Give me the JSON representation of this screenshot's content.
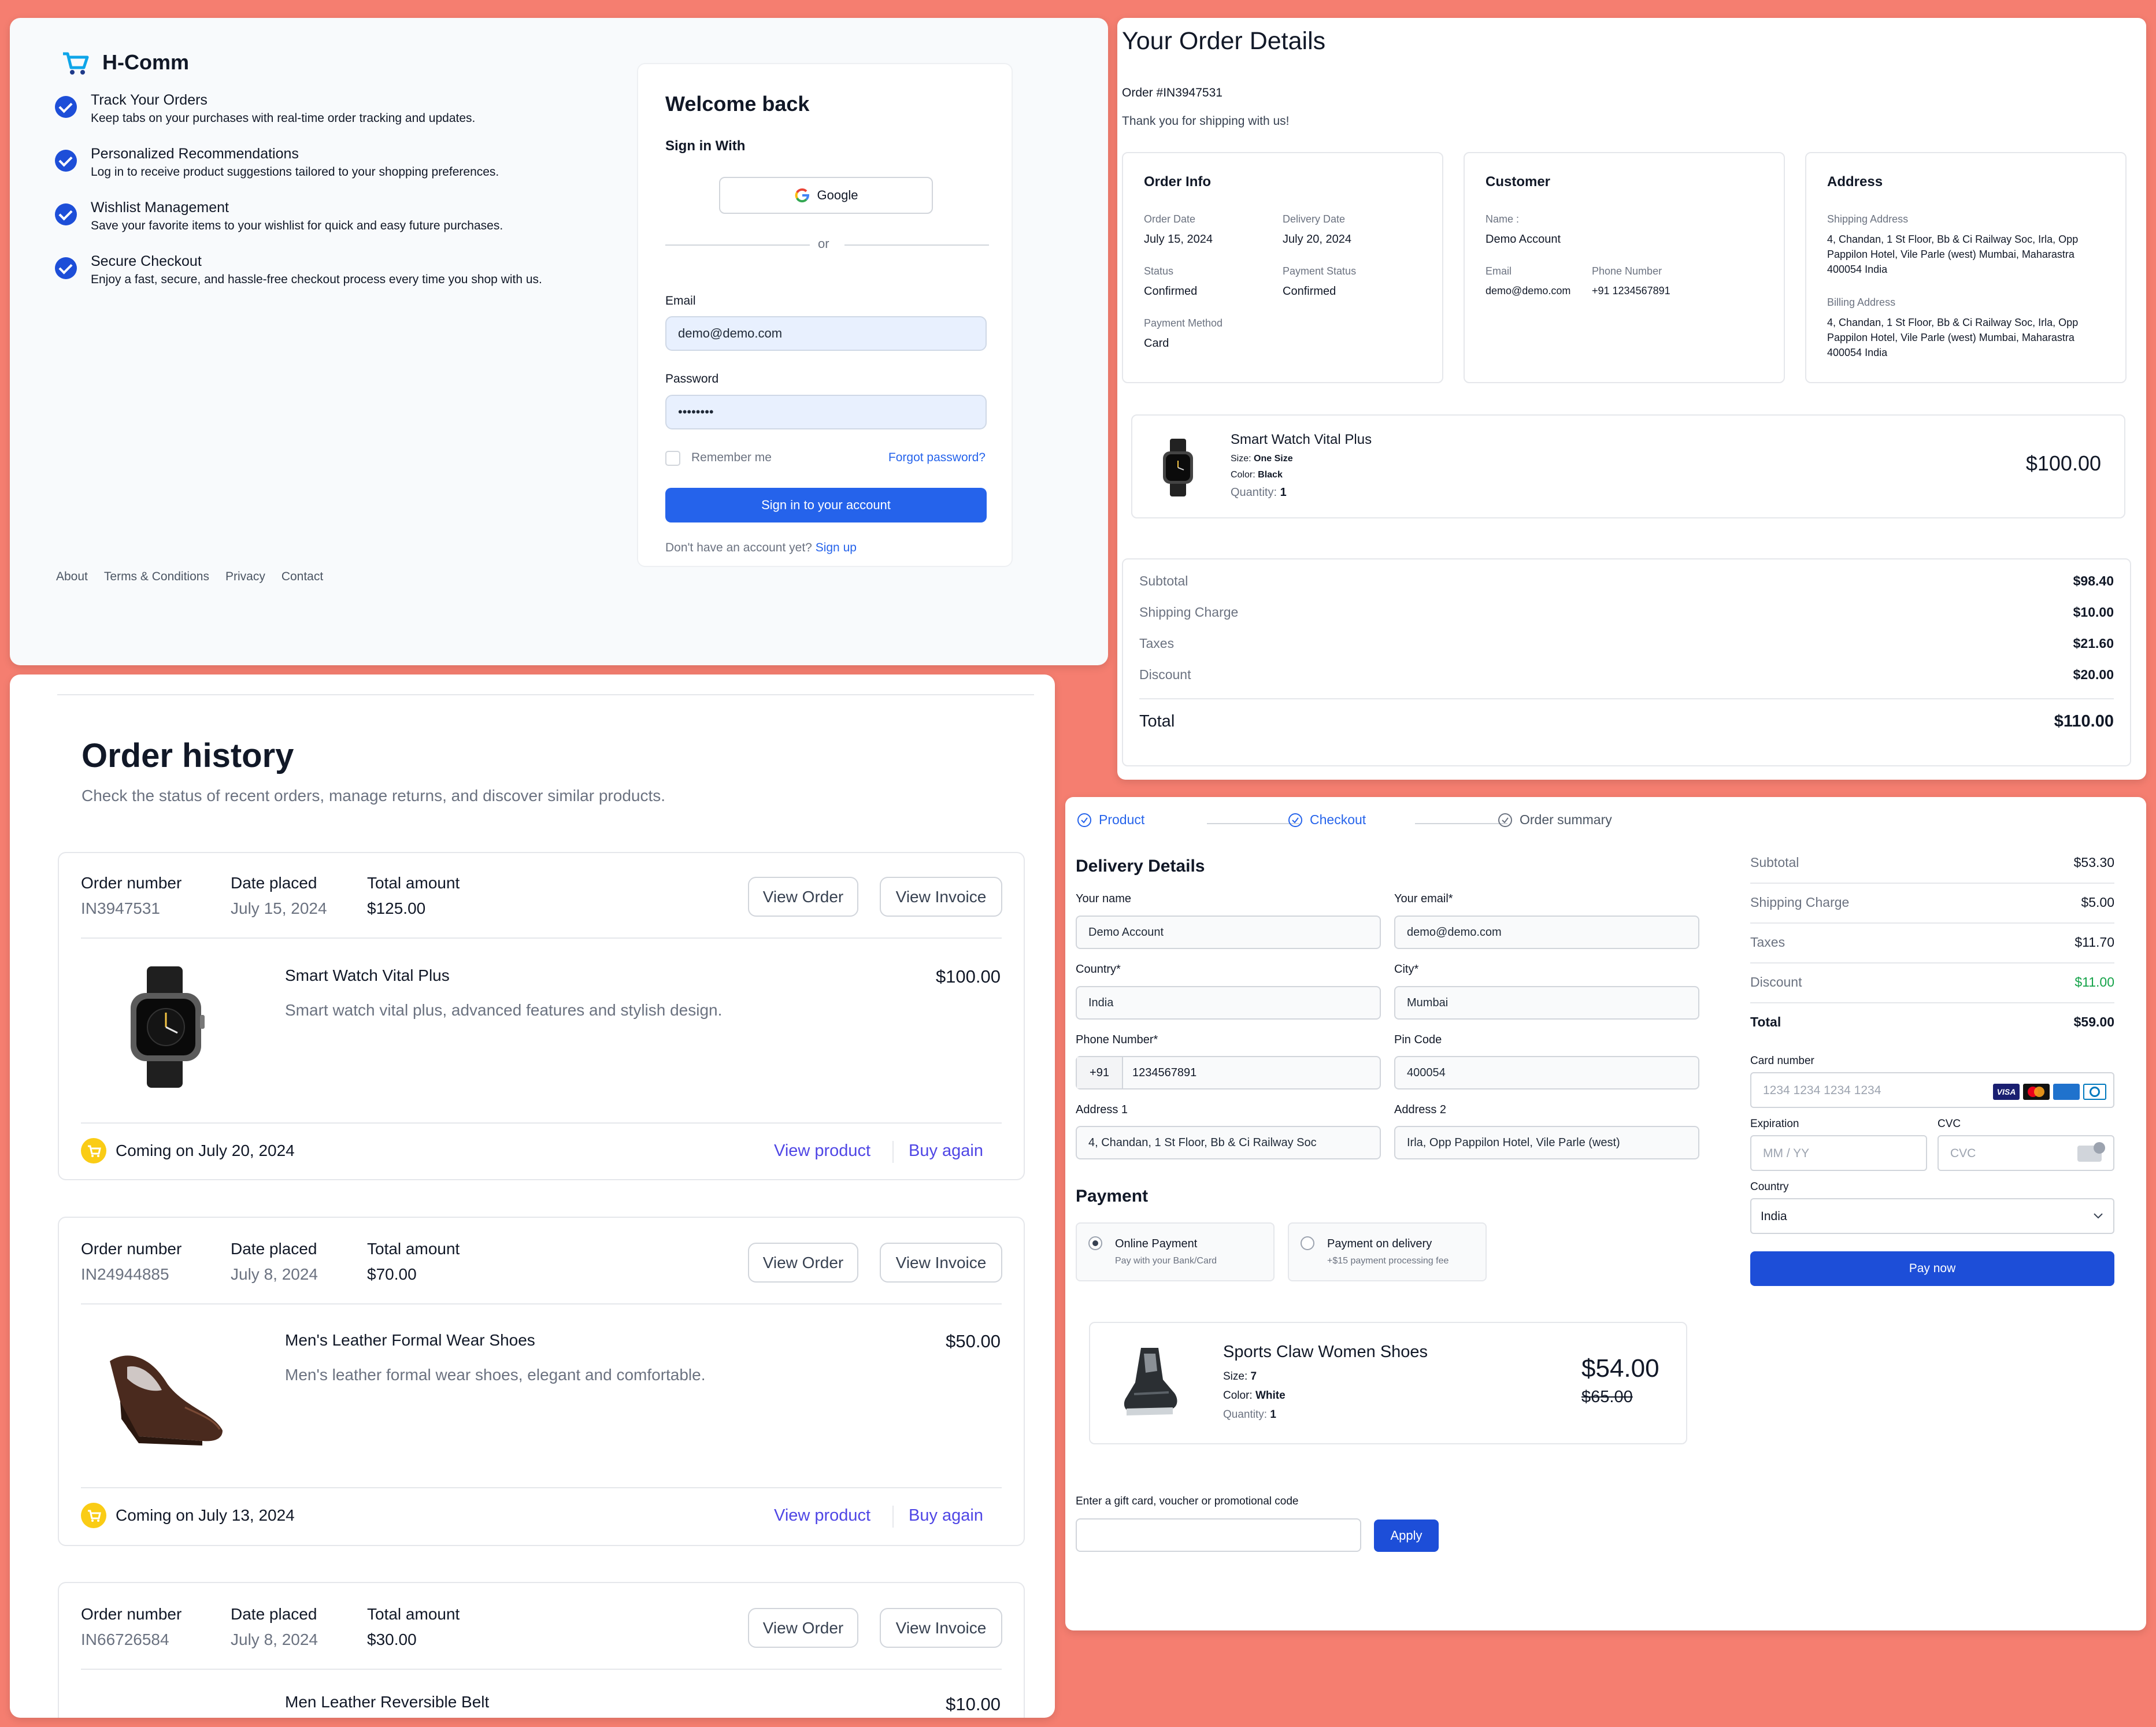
{
  "login": {
    "brand": "H-Comm",
    "features": [
      {
        "title": "Track Your Orders",
        "desc": "Keep tabs on your purchases with real-time order tracking and updates."
      },
      {
        "title": "Personalized Recommendations",
        "desc": "Log in to receive product suggestions tailored to your shopping preferences."
      },
      {
        "title": "Wishlist Management",
        "desc": "Save your favorite items to your wishlist for quick and easy future purchases."
      },
      {
        "title": "Secure Checkout",
        "desc": "Enjoy a fast, secure, and hassle-free checkout process every time you shop with us."
      }
    ],
    "footer_links": [
      "About",
      "Terms & Conditions",
      "Privacy",
      "Contact"
    ],
    "card": {
      "title": "Welcome back",
      "sign_in_with": "Sign in With",
      "google": "Google",
      "or": "or",
      "email_label": "Email",
      "email_value": "demo@demo.com",
      "password_label": "Password",
      "password_value": "••••••••",
      "remember": "Remember me",
      "forgot": "Forgot password?",
      "submit": "Sign in to your account",
      "no_account": "Don't have an account yet?",
      "signup": "Sign up"
    }
  },
  "order_details": {
    "title": "Your Order Details",
    "order_no": "Order #IN3947531",
    "thanks": "Thank you for shipping with us!",
    "info": {
      "heading": "Order Info",
      "order_date_label": "Order Date",
      "order_date": "July 15, 2024",
      "delivery_date_label": "Delivery Date",
      "delivery_date": "July 20, 2024",
      "status_label": "Status",
      "status": "Confirmed",
      "payment_status_label": "Payment Status",
      "payment_status": "Confirmed",
      "payment_method_label": "Payment Method",
      "payment_method": "Card"
    },
    "customer": {
      "heading": "Customer",
      "name_label": "Name :",
      "name": "Demo Account",
      "email_label": "Email",
      "email": "demo@demo.com",
      "phone_label": "Phone Number",
      "phone": "+91 1234567891"
    },
    "address": {
      "heading": "Address",
      "shipping_label": "Shipping Address",
      "shipping": "4, Chandan, 1 St Floor, Bb & Ci Railway Soc, Irla, Opp Pappilon Hotel, Vile Parle (west) Mumbai, Maharastra 400054 India",
      "billing_label": "Billing Address",
      "billing": "4, Chandan, 1 St Floor, Bb & Ci Railway Soc, Irla, Opp Pappilon Hotel, Vile Parle (west) Mumbai, Maharastra 400054 India"
    },
    "item": {
      "name": "Smart Watch Vital Plus",
      "size_label": "Size:",
      "size": "One Size",
      "color_label": "Color:",
      "color": "Black",
      "qty_label": "Quantity:",
      "qty": "1",
      "price": "$100.00"
    },
    "summary": [
      {
        "label": "Subtotal",
        "value": "$98.40"
      },
      {
        "label": "Shipping Charge",
        "value": "$10.00"
      },
      {
        "label": "Taxes",
        "value": "$21.60"
      },
      {
        "label": "Discount",
        "value": "$20.00"
      }
    ],
    "total_label": "Total",
    "total": "$110.00"
  },
  "history": {
    "title": "Order history",
    "subtitle": "Check the status of recent orders, manage returns, and discover similar products.",
    "col_order": "Order number",
    "col_date": "Date placed",
    "col_total": "Total amount",
    "view_order": "View Order",
    "view_invoice": "View Invoice",
    "view_product": "View product",
    "buy_again": "Buy again",
    "orders": [
      {
        "number": "IN3947531",
        "date": "July 15, 2024",
        "total": "$125.00",
        "product": "Smart Watch Vital Plus",
        "desc": "Smart watch vital plus, advanced features and stylish design.",
        "price": "$100.00",
        "coming": "Coming on July 20, 2024"
      },
      {
        "number": "IN24944885",
        "date": "July 8, 2024",
        "total": "$70.00",
        "product": "Men's Leather Formal Wear Shoes",
        "desc": "Men's leather formal wear shoes, elegant and comfortable.",
        "price": "$50.00",
        "coming": "Coming on July 13, 2024"
      },
      {
        "number": "IN66726584",
        "date": "July 8, 2024",
        "total": "$30.00",
        "product": "Men Leather Reversible Belt",
        "price": "$10.00"
      }
    ]
  },
  "checkout": {
    "steps": [
      "Product",
      "Checkout",
      "Order summary"
    ],
    "delivery_title": "Delivery Details",
    "fields": {
      "name_label": "Your name",
      "name": "Demo Account",
      "email_label": "Your email*",
      "email": "demo@demo.com",
      "country_label": "Country*",
      "country": "India",
      "city_label": "City*",
      "city": "Mumbai",
      "phone_label": "Phone Number*",
      "phone_code": "+91",
      "phone": "1234567891",
      "pin_label": "Pin Code",
      "pin": "400054",
      "addr1_label": "Address 1",
      "addr1": "4, Chandan, 1 St Floor, Bb & Ci Railway Soc",
      "addr2_label": "Address 2",
      "addr2": "Irla, Opp Pappilon Hotel, Vile Parle (west)"
    },
    "payment_title": "Payment",
    "payment_options": [
      {
        "title": "Online Payment",
        "sub": "Pay with your Bank/Card"
      },
      {
        "title": "Payment on delivery",
        "sub": "+$15 payment processing fee"
      }
    ],
    "product": {
      "name": "Sports Claw Women Shoes",
      "size_label": "Size:",
      "size": "7",
      "color_label": "Color:",
      "color": "White",
      "qty_label": "Quantity:",
      "qty": "1",
      "price": "$54.00",
      "old_price": "$65.00"
    },
    "promo_label": "Enter a gift card, voucher or promotional code",
    "apply": "Apply",
    "summary": [
      {
        "label": "Subtotal",
        "value": "$53.30"
      },
      {
        "label": "Shipping Charge",
        "value": "$5.00"
      },
      {
        "label": "Taxes",
        "value": "$11.70"
      },
      {
        "label": "Discount",
        "value": "$11.00"
      }
    ],
    "total_label": "Total",
    "total": "$59.00",
    "card_label": "Card number",
    "card_placeholder": "1234 1234 1234 1234",
    "exp_label": "Expiration",
    "exp_placeholder": "MM / YY",
    "cvc_label": "CVC",
    "cvc_placeholder": "CVC",
    "country_label": "Country",
    "country": "India",
    "pay": "Pay now",
    "discount_color": "#16a34a"
  }
}
